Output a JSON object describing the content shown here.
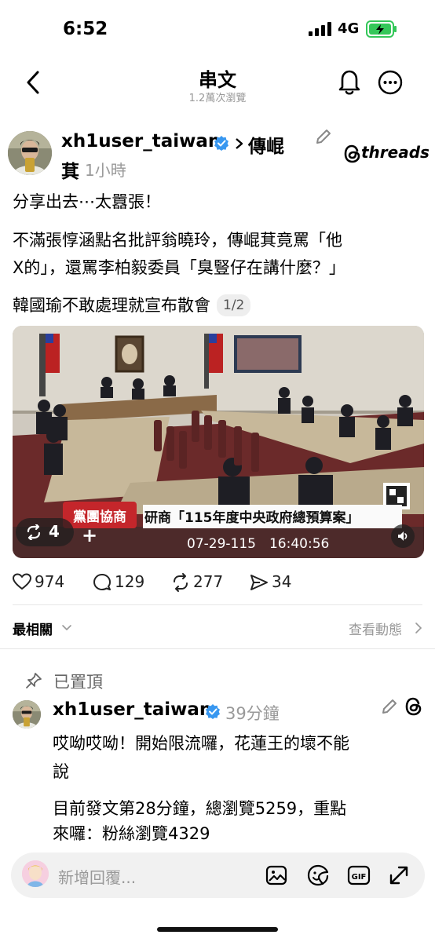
{
  "status_bar": {
    "time": "6:52",
    "network": "4G"
  },
  "header": {
    "title": "串文",
    "views": "1.2萬次瀏覽"
  },
  "post": {
    "username": "xh1user_taiwan",
    "mention_line1": "傳崐",
    "mention_line2": "萁",
    "time_ago": "1小時",
    "brand": "threads",
    "lines": [
      "分享出去⋯太囂張！",
      "不滿張惇涵點名批評翁曉玲，傳崐萁竟罵「他",
      "X的」，還罵李柏毅委員「臭豎仔在講什麼？」",
      "韓國瑜不敢處理就宣布散會"
    ],
    "pager": "1/2",
    "image": {
      "banner_red": "黨團協商",
      "banner_main": "研商「115年度中央政府總預算案」",
      "timestamp": "07-29-115　16:40:56",
      "repost_count": "4",
      "plus": "+"
    },
    "actions": {
      "likes": "974",
      "comments": "129",
      "reposts": "277",
      "shares": "34"
    }
  },
  "sort": {
    "label": "最相關",
    "activity": "查看動態"
  },
  "pinned": {
    "label": "已置頂",
    "username": "xh1user_taiwan",
    "time_ago": "39分鐘",
    "lines": [
      "哎呦哎呦！開始限流囉，花蓮王的壞不能",
      "說",
      "目前發文第28分鐘，總瀏覽5259，重點",
      "來囉：粉絲瀏覽4329"
    ]
  },
  "composer": {
    "placeholder": "新增回覆..."
  },
  "colors": {
    "verified": "#3897f0",
    "muted": "#999999",
    "battery": "#34c759"
  }
}
